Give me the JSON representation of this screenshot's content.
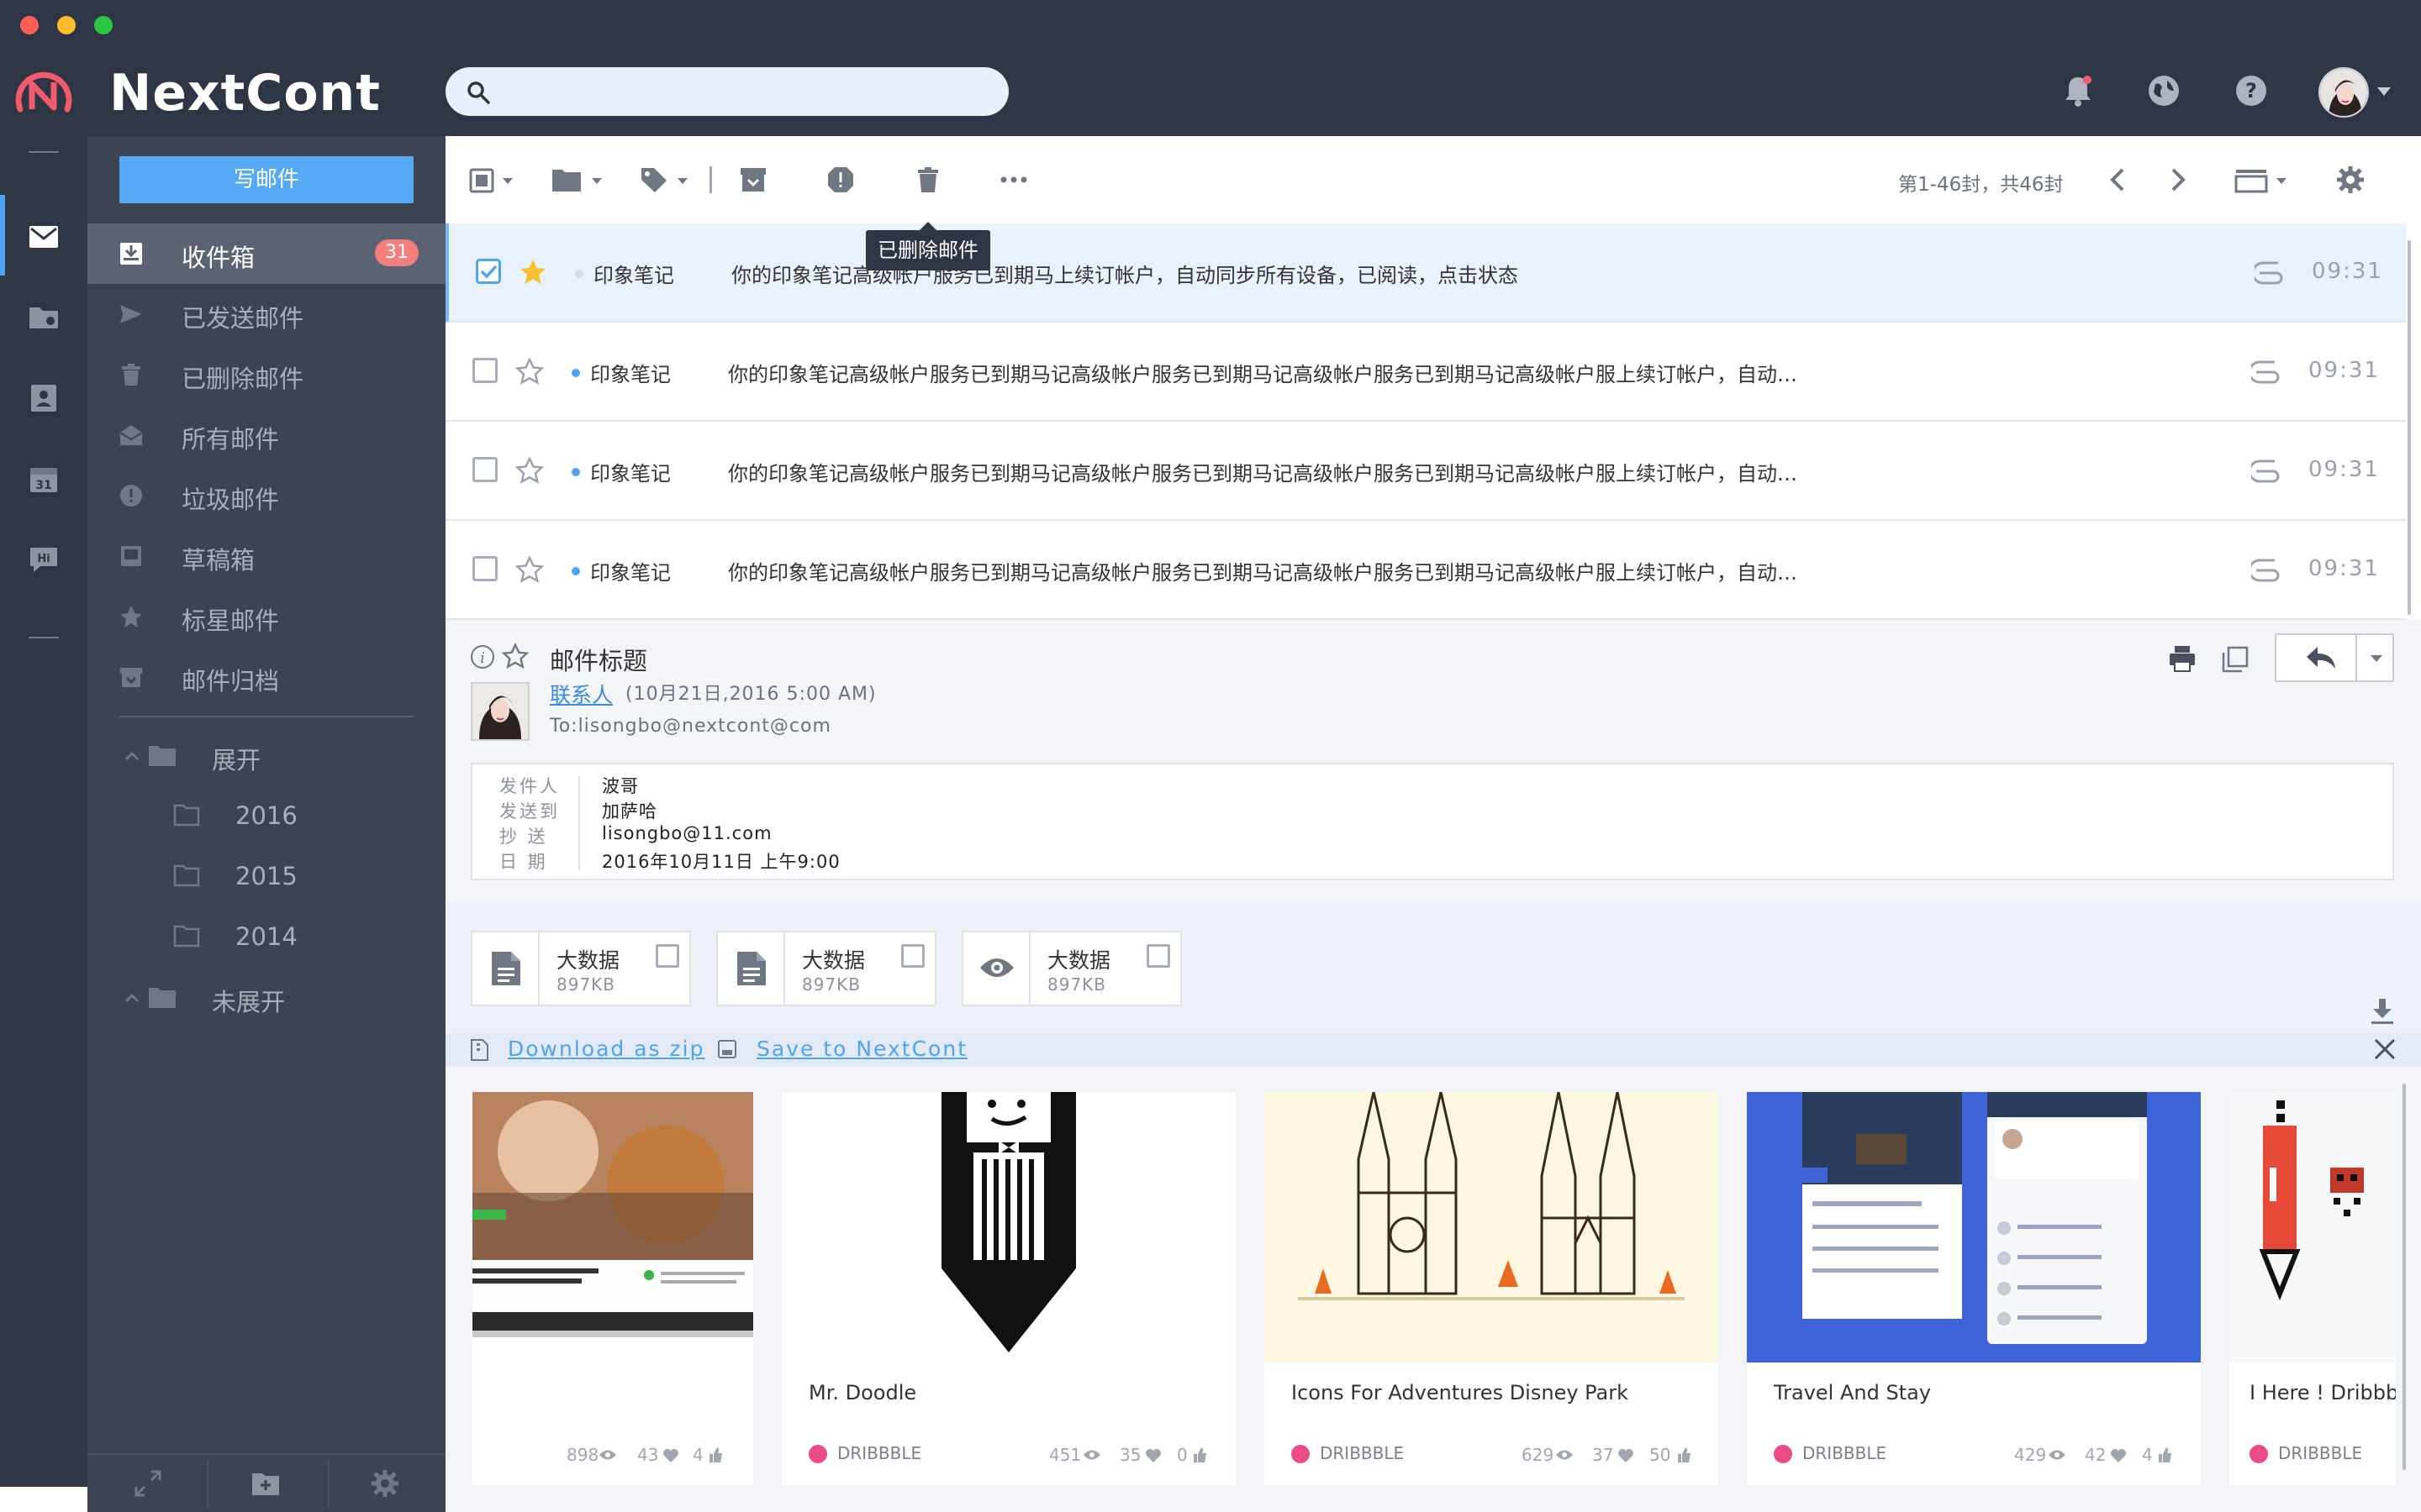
{
  "app": {
    "name": "NextCont"
  },
  "search": {
    "placeholder": ""
  },
  "sidebar": {
    "compose_label": "写邮件",
    "items": [
      {
        "label": "收件箱",
        "badge": "31",
        "icon": "inbox-icon"
      },
      {
        "label": "已发送邮件",
        "icon": "send-icon"
      },
      {
        "label": "已删除邮件",
        "icon": "trash-icon"
      },
      {
        "label": "所有邮件",
        "icon": "all-mail-icon"
      },
      {
        "label": "垃圾邮件",
        "icon": "spam-icon"
      },
      {
        "label": "草稿箱",
        "icon": "draft-icon"
      },
      {
        "label": "标星邮件",
        "icon": "star-icon"
      },
      {
        "label": "邮件归档",
        "icon": "archive-icon"
      }
    ],
    "folders": [
      {
        "label": "展开",
        "children": [
          "2016",
          "2015",
          "2014"
        ]
      },
      {
        "label": "未展开"
      }
    ]
  },
  "toolbar": {
    "tooltip": "已删除邮件",
    "pager": "第1-46封，共46封"
  },
  "mails": [
    {
      "sender": "印象笔记",
      "subject": "你的印象笔记高级帐户服务已到期马上续订帐户，自动同步所有设备，已阅读，点击状态",
      "time": "09:31",
      "checked": true,
      "starred": true,
      "unread": false
    },
    {
      "sender": "印象笔记",
      "subject": "你的印象笔记高级帐户服务已到期马记高级帐户服务已到期马记高级帐户服务已到期马记高级帐户服上续订帐户，自动同步所有设备，随时随地高效率…",
      "time": "09:31",
      "checked": false,
      "starred": false,
      "unread": true
    },
    {
      "sender": "印象笔记",
      "subject": "你的印象笔记高级帐户服务已到期马记高级帐户服务已到期马记高级帐户服务已到期马记高级帐户服上续订帐户，自动同步所有设备，随时随地高效率…",
      "time": "09:31",
      "checked": false,
      "starred": false,
      "unread": true
    },
    {
      "sender": "印象笔记",
      "subject": "你的印象笔记高级帐户服务已到期马记高级帐户服务已到期马记高级帐户服务已到期马记高级帐户服上续订帐户，自动同步所有设备，随时随地高效率…",
      "time": "09:31",
      "checked": false,
      "starred": false,
      "unread": true
    }
  ],
  "reader": {
    "title": "邮件标题",
    "contact": "联系人",
    "date": "(10月21日,2016 5:00 AM)",
    "to": "To:lisongbo@nextcont@com",
    "details": [
      {
        "key": "发件人",
        "value": "波哥"
      },
      {
        "key": "发送到",
        "value": "加萨哈"
      },
      {
        "key": "抄 送",
        "value": "lisongbo@11.com"
      },
      {
        "key": "日 期",
        "value": "2016年10月11日 上午9:00"
      }
    ],
    "attachments": [
      {
        "name": "大数据",
        "size": "897KB",
        "icon": "document-icon"
      },
      {
        "name": "大数据",
        "size": "897KB",
        "icon": "document-icon"
      },
      {
        "name": "大数据",
        "size": "897KB",
        "icon": "eye-icon"
      }
    ],
    "download_zip": "Download as zip",
    "save_to": "Save to NextCont"
  },
  "gallery": [
    {
      "title": "",
      "source": "",
      "views": "898",
      "likes": "43",
      "comments": "4"
    },
    {
      "title": "Mr. Doodle",
      "source": "DRIBBBLE",
      "views": "451",
      "likes": "35",
      "comments": "0"
    },
    {
      "title": "Icons For Adventures Disney Park",
      "source": "DRIBBBLE",
      "views": "629",
      "likes": "37",
      "comments": "50"
    },
    {
      "title": "Travel And Stay",
      "source": "DRIBBBLE",
      "views": "429",
      "likes": "42",
      "comments": "4"
    },
    {
      "title": "I Here ! Dribbb",
      "source": "DRIBBBLE",
      "views": "",
      "likes": "",
      "comments": ""
    }
  ],
  "colors": {
    "accent": "#55a9f5",
    "header": "#2e3544",
    "sidebar": "#3c4453",
    "badge": "#f27e7e",
    "dribbble": "#ea4c89"
  }
}
